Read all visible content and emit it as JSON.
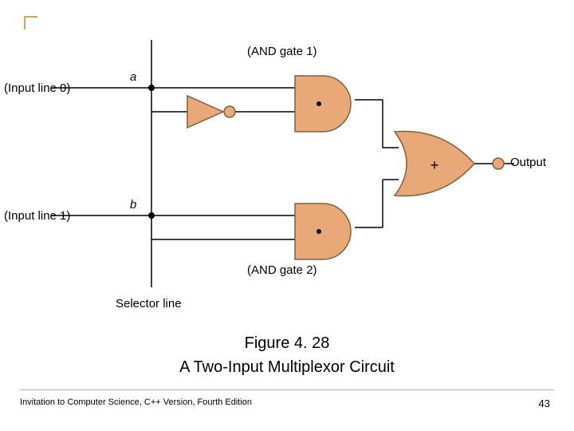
{
  "labels": {
    "input0": "(Input line 0)",
    "input1": "(Input line 1)",
    "a": "a",
    "b": "b",
    "and1": "(AND gate 1)",
    "and2": "(AND gate 2)",
    "selector": "Selector line",
    "plus": "+",
    "output": "Output"
  },
  "caption": {
    "line1": "Figure 4. 28",
    "line2": "A Two-Input Multiplexor Circuit"
  },
  "footer": "Invitation to Computer Science, C++ Version, Fourth Edition",
  "page": "43",
  "colors": {
    "gate_fill": "#e8a878",
    "gate_stroke": "#806040",
    "wire": "#000000"
  }
}
